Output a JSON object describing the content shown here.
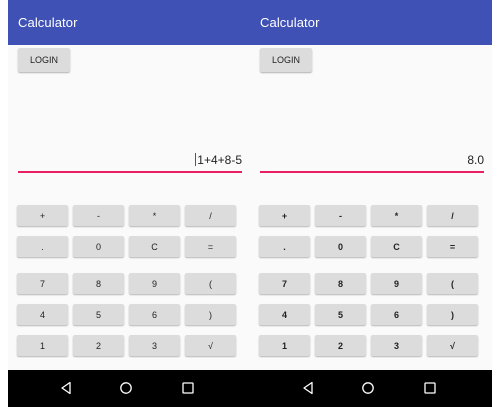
{
  "screens": [
    {
      "id": "left",
      "app_title": "Calculator",
      "login_label": "LOGIN",
      "display_value": "1+4+8-5",
      "show_cursor": true
    },
    {
      "id": "right",
      "app_title": "Calculator",
      "login_label": "LOGIN",
      "display_value": "8.0",
      "show_cursor": false
    }
  ],
  "keypad": [
    [
      {
        "label": "+",
        "name": "plus-key"
      },
      {
        "label": "-",
        "name": "minus-key"
      },
      {
        "label": "*",
        "name": "multiply-key"
      },
      {
        "label": "/",
        "name": "divide-key"
      }
    ],
    [
      {
        "label": ".",
        "name": "decimal-key"
      },
      {
        "label": "0",
        "name": "digit-0-key"
      },
      {
        "label": "C",
        "name": "clear-key"
      },
      {
        "label": "=",
        "name": "equals-key"
      }
    ],
    [
      {
        "label": "7",
        "name": "digit-7-key"
      },
      {
        "label": "8",
        "name": "digit-8-key"
      },
      {
        "label": "9",
        "name": "digit-9-key"
      },
      {
        "label": "(",
        "name": "open-paren-key"
      }
    ],
    [
      {
        "label": "4",
        "name": "digit-4-key"
      },
      {
        "label": "5",
        "name": "digit-5-key"
      },
      {
        "label": "6",
        "name": "digit-6-key"
      },
      {
        "label": ")",
        "name": "close-paren-key"
      }
    ],
    [
      {
        "label": "1",
        "name": "digit-1-key"
      },
      {
        "label": "2",
        "name": "digit-2-key"
      },
      {
        "label": "3",
        "name": "digit-3-key"
      },
      {
        "label": "√",
        "name": "sqrt-key"
      }
    ]
  ],
  "nav_icons": [
    "back-icon",
    "home-icon",
    "recents-icon"
  ],
  "colors": {
    "app_bar": "#3f51b5",
    "input_underline": "#e91e63",
    "key_background": "#dcdcdc",
    "nav_bar": "#000000"
  }
}
